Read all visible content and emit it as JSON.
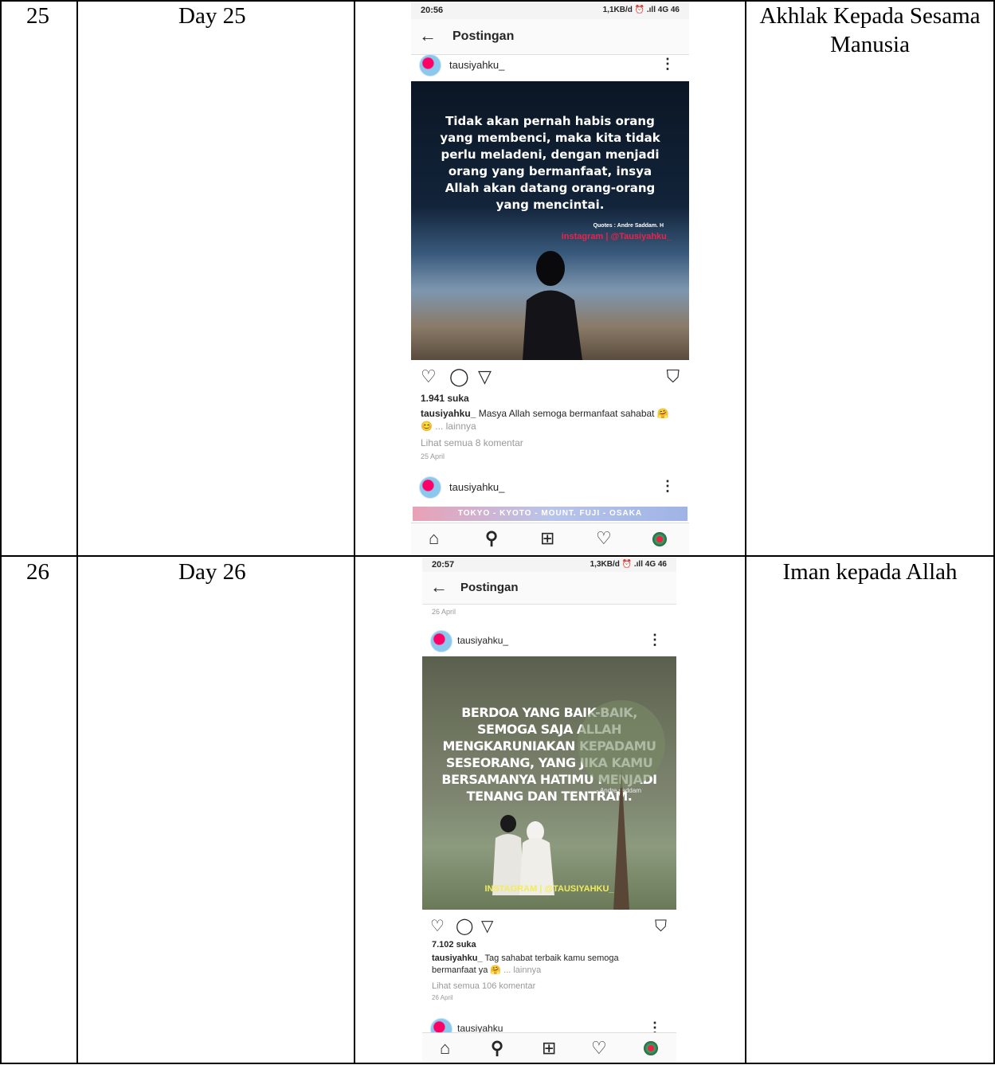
{
  "rows": [
    {
      "number": "25",
      "day": "Day 25",
      "topic": "Akhlak Kepada Sesama Manusia",
      "phone": {
        "time": "20:56",
        "network": "1,1KB/d ⏰ .ıll 4G 46",
        "header_title": "Postingan",
        "back_icon": "arrow-left-icon",
        "username": "tausiyahku_",
        "quote": "Tidak akan pernah habis orang yang membenci, maka kita tidak perlu meladeni, dengan menjadi orang yang bermanfaat, insya Allah akan datang orang-orang yang mencintai.",
        "quote_credit": "Quotes : Andre Saddam. H",
        "watermark": "instagram | @Tausiyahku_",
        "likes": "1.941 suka",
        "caption_user": "tausiyahku_",
        "caption_text": "Masya Allah semoga bermanfaat sahabat 🤗 😊",
        "caption_more": "... lainnya",
        "comments_link": "Lihat semua 8 komentar",
        "date": "25 April",
        "next_username": "tausiyahku_",
        "banner_text": "TOKYO - KYOTO - MOUNT. FUJI - OSAKA",
        "sky_color": "#0d1a2a",
        "earth_color": "#5a7a9a"
      }
    },
    {
      "number": "26",
      "day": "Day 26",
      "topic": "Iman kepada Allah",
      "phone": {
        "time": "20:57",
        "network": "1,3KB/d ⏰ .ıll 4G 46",
        "header_title": "Postingan",
        "back_icon": "arrow-left-icon",
        "top_date": "26 April",
        "username": "tausiyahku_",
        "quote": "BERDOA YANG BAIK-BAIK, SEMOGA SAJA ALLAH MENGKARUNIAKAN KEPADAMU SESEORANG, YANG JIKA KAMU BERSAMANYA HATIMU MENJADI TENANG DAN TENTRAM.",
        "quote_credit": "- Andre saddam",
        "watermark": "INSTAGRAM | @TAUSIYAHKU_",
        "likes": "7.102 suka",
        "caption_user": "tausiyahku_",
        "caption_text": "Tag sahabat terbaik kamu semoga bermanfaat ya 🤗",
        "caption_more": "... lainnya",
        "comments_link": "Lihat semua 106 komentar",
        "date": "26 April",
        "next_username": "tausiyahku_",
        "photo_color": "#6b7a60"
      }
    }
  ],
  "tabbar_icons": [
    "home-icon",
    "search-icon",
    "add-post-icon",
    "heart-icon",
    "profile-icon"
  ]
}
